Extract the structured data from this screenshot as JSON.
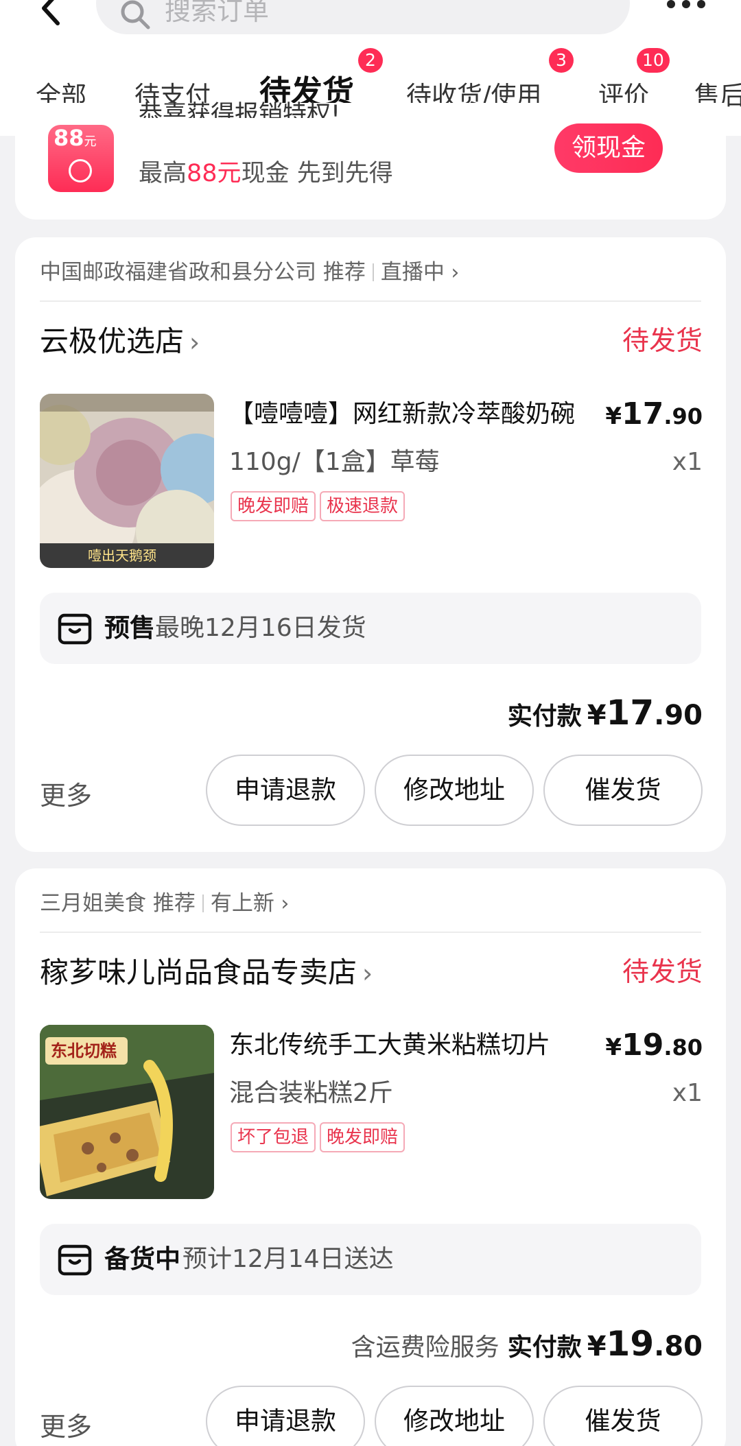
{
  "header": {
    "search_placeholder": "搜索订单"
  },
  "tabs": [
    {
      "label": "全部"
    },
    {
      "label": "待支付"
    },
    {
      "label": "待发货",
      "badge": "2"
    },
    {
      "label": "待收货/使用",
      "badge": "3"
    },
    {
      "label": "评价",
      "badge": "10"
    },
    {
      "label": "售后"
    }
  ],
  "promo": {
    "icon_amount": "88",
    "icon_unit": "元",
    "title": "恭喜获得报销特权!",
    "sub_prefix": "最高",
    "sub_highlight": "88元",
    "sub_suffix": "现金 先到先得",
    "button": "领现金"
  },
  "orders": [
    {
      "meta_source": "中国邮政福建省政和县分公司",
      "meta_recommend": "推荐",
      "meta_live": "直播中",
      "shop_name": "云极优选店",
      "status": "待发货",
      "title": "【噎噎噎】网红新款冷萃酸奶碗",
      "price_currency": "¥",
      "price_int": "17",
      "price_dec": ".90",
      "spec": "110g/【1盒】草莓",
      "qty": "x1",
      "tags": [
        "晚发即赔",
        "极速退款"
      ],
      "ship_kind": "预售",
      "ship_text": "最晚12月16日发货",
      "total_note": "",
      "total_label": "实付款",
      "total_currency": "¥",
      "total_int": "17",
      "total_dec": ".90",
      "more": "更多",
      "actions": [
        "申请退款",
        "修改地址",
        "催发货"
      ],
      "image_caption": "噎出天鹅颈"
    },
    {
      "meta_source": "三月姐美食",
      "meta_recommend": "推荐",
      "meta_live": "有上新",
      "shop_name": "稼芗味儿尚品食品专卖店",
      "status": "待发货",
      "title": "东北传统手工大黄米粘糕切片",
      "price_currency": "¥",
      "price_int": "19",
      "price_dec": ".80",
      "spec": "混合装粘糕2斤",
      "qty": "x1",
      "tags": [
        "坏了包退",
        "晚发即赔"
      ],
      "ship_kind": "备货中",
      "ship_text": "预计12月14日送达",
      "total_note": "含运费险服务",
      "total_label": "实付款",
      "total_currency": "¥",
      "total_int": "19",
      "total_dec": ".80",
      "more": "更多",
      "actions": [
        "申请退款",
        "修改地址",
        "催发货"
      ],
      "image_caption": "东北切糕"
    }
  ],
  "colors": {
    "accent": "#fe2c55",
    "status_red": "#e9344d",
    "tag_border": "#f5a9b6"
  }
}
